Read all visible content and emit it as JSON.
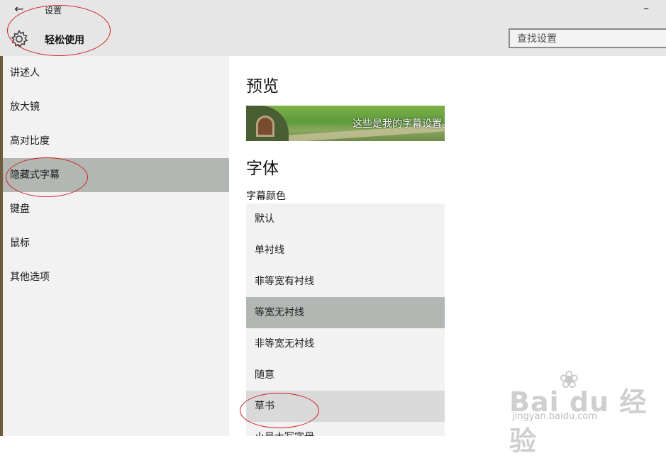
{
  "window": {
    "title": "设置",
    "back_icon": "←",
    "minimize_icon": "–"
  },
  "header": {
    "page_title": "轻松使用",
    "search": {
      "placeholder": "查找设置",
      "value": ""
    }
  },
  "sidebar": {
    "items": [
      {
        "label": "讲述人"
      },
      {
        "label": "放大镜"
      },
      {
        "label": "高对比度"
      },
      {
        "label": "隐藏式字幕",
        "selected": true
      },
      {
        "label": "键盘"
      },
      {
        "label": "鼠标"
      },
      {
        "label": "其他选项"
      }
    ]
  },
  "main": {
    "preview_heading": "预览",
    "preview_text": "这些是我的字幕设置。",
    "font_heading": "字体",
    "caption_color_label": "字幕颜色",
    "font_options": [
      {
        "label": "默认"
      },
      {
        "label": "单衬线"
      },
      {
        "label": "非等宽有衬线"
      },
      {
        "label": "等宽无衬线",
        "selected": true
      },
      {
        "label": "非等宽无衬线"
      },
      {
        "label": "随意"
      },
      {
        "label": "草书",
        "hovered": true
      },
      {
        "label": "小号大写字母"
      }
    ]
  },
  "watermark": {
    "brand": "Bai du 经验",
    "url": "jingyan.baidu.com"
  },
  "colors": {
    "titlebar_bg": "#e6e6e6",
    "sidebar_bg": "#f2f2f2",
    "selected_bg": "#b3b7b3",
    "annotation_red": "#d21f1f"
  }
}
